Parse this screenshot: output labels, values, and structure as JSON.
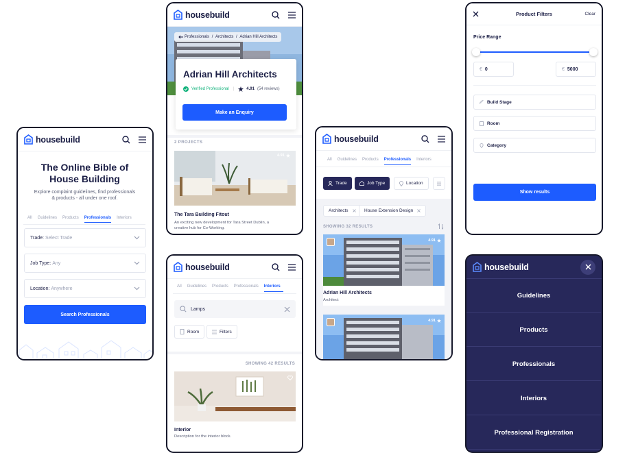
{
  "brand": {
    "name": "housebuild",
    "accent": "#1d5cff",
    "navy": "#27285a"
  },
  "phone1": {
    "hero_title_line1": "The Online Bible of",
    "hero_title_line2": "House Building",
    "hero_sub_line1": "Explore complaint guidelines, find professionals",
    "hero_sub_line2": "& products - all under one roof.",
    "tabs": [
      "All",
      "Guidelines",
      "Products",
      "Professionals",
      "Interiors"
    ],
    "trade_label": "Trade:",
    "trade_value": "Select Trade",
    "jobtype_label": "Job Type:",
    "jobtype_value": "Any",
    "location_label": "Location:",
    "location_value": "Anywhere",
    "search_button": "Search Professionals"
  },
  "phone2": {
    "breadcrumb_1": "Professionals",
    "breadcrumb_2": "Architects",
    "breadcrumb_3": "Adrian Hill Architects",
    "name": "Adrian Hill Architects",
    "verified": "Verified Professional",
    "rating": "4.91",
    "reviews": "(54 reviews)",
    "enquiry_button": "Make an Enquiry",
    "projects_label": "2 PROJECTS",
    "card_rating": "4.91",
    "project_title": "The Tara Building Fitout",
    "project_desc_line1": "An exciting new development for Tara Street Dublin, a",
    "project_desc_line2": "creative hub for Co-Working."
  },
  "phone3": {
    "tabs": [
      "All",
      "Guidelines",
      "Products",
      "Professionals",
      "Interiors"
    ],
    "search_value": "Lamps",
    "chip_room": "Room",
    "chip_filters": "Filters",
    "results": "SHOWING 42 RESULTS",
    "item_title": "Interior",
    "item_desc": "Description for the interior block."
  },
  "phone4": {
    "tabs": [
      "All",
      "Guidelines",
      "Products",
      "Professionals",
      "Interiors"
    ],
    "chip_trade": "Trade",
    "chip_job": "Job Type",
    "chip_location": "Location",
    "tag1": "Architects",
    "tag2": "House Extension Design",
    "results": "SHOWING 32 RESULTS",
    "card_rating": "4.91",
    "card_title": "Adrian Hill Architects",
    "card_sub": "Architect",
    "card2_rating": "4.91"
  },
  "phone5": {
    "title": "Product Filters",
    "clear": "Clear",
    "price_label": "Price Range",
    "price_range": {
      "min": 0,
      "max": 5000,
      "low_pct": 0,
      "high_pct": 0.98
    },
    "currency": "€",
    "min_value": "0",
    "max_value": "5000",
    "build_stage": "Build Stage",
    "room": "Room",
    "category": "Category",
    "show_button": "Show results"
  },
  "phone6": {
    "menu": [
      "Guidelines",
      "Products",
      "Professionals",
      "Interiors",
      "Professional Registration"
    ]
  }
}
